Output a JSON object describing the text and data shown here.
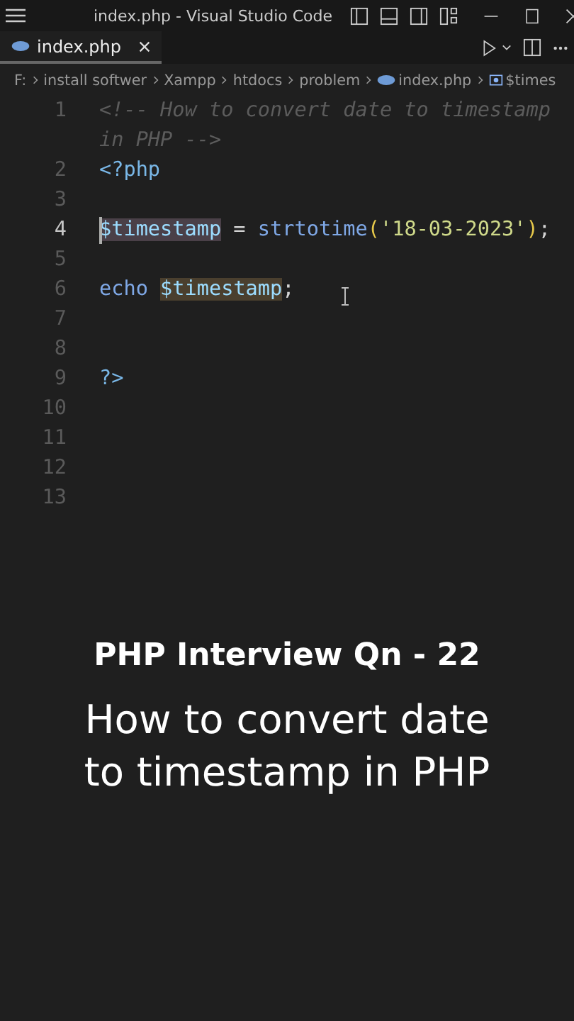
{
  "window": {
    "title": "index.php - Visual Studio Code"
  },
  "tabs": [
    {
      "label": "index.php",
      "selected": true
    }
  ],
  "breadcrumbs": [
    "F:",
    "install softwer",
    "Xampp",
    "htdocs",
    "problem",
    "index.php",
    "$times"
  ],
  "editor": {
    "lines": [
      {
        "number": "1",
        "active": false,
        "tokens": [
          {
            "text": "<!-- How to convert date to timestamp in PHP -->",
            "kind": "comment"
          }
        ]
      },
      {
        "number": "2",
        "active": false,
        "tokens": [
          {
            "text": "<?php",
            "kind": "tag"
          }
        ]
      },
      {
        "number": "3",
        "active": false
      },
      {
        "number": "4",
        "active": true,
        "tokens": [
          {
            "text": "$timestamp",
            "kind": "var",
            "highlighted": true
          },
          {
            "text": " = ",
            "kind": "op"
          },
          {
            "text": "strtotime",
            "kind": "func"
          },
          {
            "text": "(",
            "kind": "paren"
          },
          {
            "text": "'18-03-2023'",
            "kind": "string"
          },
          {
            "text": ")",
            "kind": "paren"
          },
          {
            "text": ";",
            "kind": "op"
          }
        ]
      },
      {
        "number": "5",
        "active": false
      },
      {
        "number": "6",
        "active": false,
        "tokens": [
          {
            "text": "echo ",
            "kind": "keyword"
          },
          {
            "text": "$timestamp",
            "kind": "var",
            "highlighted": true
          },
          {
            "text": ";",
            "kind": "op"
          }
        ]
      },
      {
        "number": "7",
        "active": false
      },
      {
        "number": "8",
        "active": false
      },
      {
        "number": "9",
        "active": false,
        "tokens": [
          {
            "text": "?>",
            "kind": "tag"
          }
        ]
      },
      {
        "number": "10",
        "active": false
      },
      {
        "number": "11",
        "active": false
      },
      {
        "number": "12",
        "active": false
      },
      {
        "number": "13",
        "active": false
      }
    ]
  },
  "caption": {
    "heading": "PHP Interview Qn - 22",
    "lines": [
      "How to convert date",
      "to timestamp in PHP"
    ]
  }
}
